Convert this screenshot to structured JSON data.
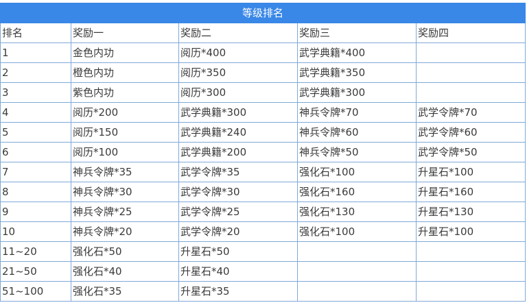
{
  "table": {
    "title": "等级排名",
    "headers": [
      "排名",
      "奖励一",
      "奖励二",
      "奖励三",
      "奖励四"
    ],
    "rows": [
      [
        "1",
        "金色内功",
        "阅历*400",
        "武学典籍*400",
        ""
      ],
      [
        "2",
        "橙色内功",
        "阅历*350",
        "武学典籍*350",
        ""
      ],
      [
        "3",
        "紫色内功",
        "阅历*300",
        "武学典籍*300",
        ""
      ],
      [
        "4",
        "阅历*200",
        "武学典籍*300",
        "神兵令牌*70",
        "武学令牌*70"
      ],
      [
        "5",
        "阅历*150",
        "武学典籍*240",
        "神兵令牌*60",
        "武学令牌*60"
      ],
      [
        "6",
        "阅历*100",
        "武学典籍*200",
        "神兵令牌*50",
        "武学令牌*50"
      ],
      [
        "7",
        "神兵令牌*35",
        "武学令牌*35",
        "强化石*100",
        "升星石*100"
      ],
      [
        "8",
        "神兵令牌*30",
        "武学令牌*30",
        "强化石*160",
        "升星石*160"
      ],
      [
        "9",
        "神兵令牌*25",
        "武学令牌*25",
        "强化石*130",
        "升星石*130"
      ],
      [
        "10",
        "神兵令牌*20",
        "武学令牌*20",
        "强化石*100",
        "升星石*100"
      ],
      [
        "11~20",
        "强化石*50",
        "升星石*50",
        "",
        ""
      ],
      [
        "21~50",
        "强化石*40",
        "升星石*40",
        "",
        ""
      ],
      [
        "51~100",
        "强化石*35",
        "升星石*35",
        "",
        ""
      ]
    ]
  }
}
